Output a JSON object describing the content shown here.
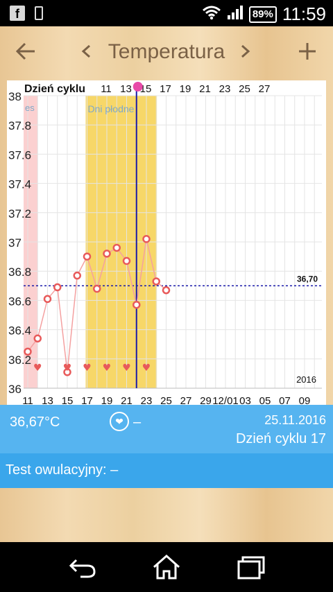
{
  "status_bar": {
    "battery": "89%",
    "time": "11:59"
  },
  "toolbar": {
    "title": "Temperatura",
    "back_icon": "arrow-left-icon",
    "prev_icon": "chevron-left-icon",
    "next_icon": "chevron-right-icon",
    "add_icon": "plus-icon"
  },
  "chart_data": {
    "type": "line",
    "top_axis_label": "Dzień cyklu",
    "top_ticks": [
      "11",
      "13",
      "15",
      "17",
      "19",
      "21",
      "23",
      "25",
      "27"
    ],
    "bottom_ticks": [
      "11",
      "13",
      "15",
      "17",
      "19",
      "21",
      "23",
      "25",
      "27",
      "29",
      "12/01",
      "03",
      "05",
      "07",
      "09"
    ],
    "y_ticks": [
      "36",
      "36.2",
      "36.4",
      "36.6",
      "36.8",
      "37",
      "37.2",
      "37.4",
      "37.6",
      "37.8",
      "38"
    ],
    "ylim": [
      36,
      38
    ],
    "year_label": "2016",
    "period_label": "es",
    "fertile_label": "Dni płodne",
    "coverline_label": "36,70",
    "coverline": 36.7,
    "x_index": [
      0,
      1,
      2,
      3,
      4,
      5,
      6,
      7,
      8,
      9,
      10,
      11,
      12,
      13,
      14,
      15
    ],
    "temperatures": [
      36.25,
      36.34,
      36.61,
      36.69,
      36.11,
      36.77,
      36.9,
      36.68,
      36.92,
      36.96,
      36.87,
      36.57,
      37.02,
      36.73,
      36.67,
      null
    ],
    "heart_days": [
      1,
      4,
      6,
      8,
      10,
      12
    ],
    "selected_day_index": 11,
    "fertile_range": [
      6,
      12.5
    ]
  },
  "info": {
    "temperature": "36,67°C",
    "intercourse": "–",
    "date": "25.11.2016",
    "cycle_day": "Dzień cyklu 17"
  },
  "ovulation_test": {
    "label": "Test owulacyjny: –"
  },
  "colors": {
    "accent": "#56b4f0",
    "fertile": "#f7d768",
    "period": "#fbd0d0",
    "point": "#e85a5a",
    "coverline": "#1a1aa8"
  }
}
